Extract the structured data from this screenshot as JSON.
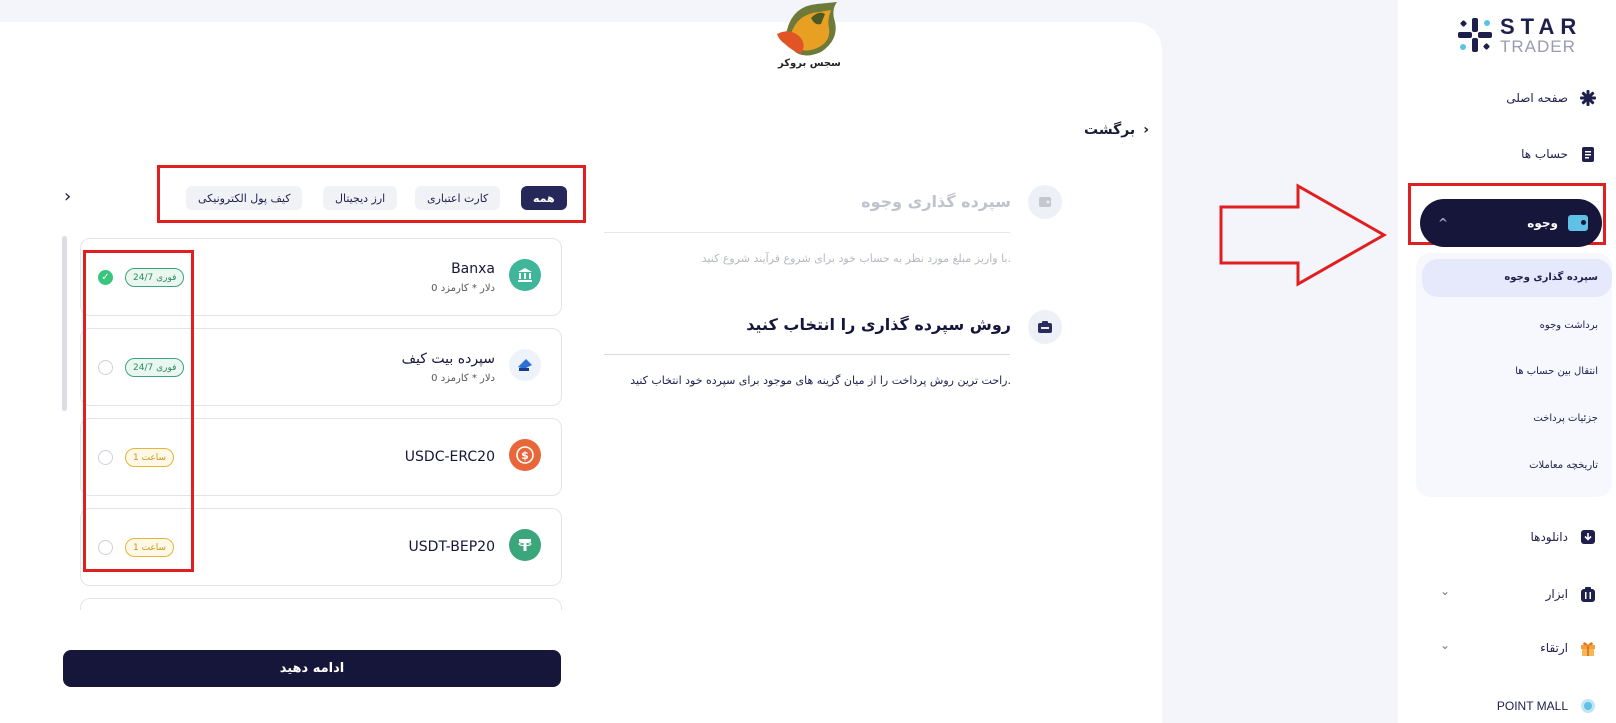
{
  "brand": {
    "name_fa": "سجس بروکر"
  },
  "logo": {
    "line1": "STAR",
    "line2": "TRADER"
  },
  "sidebar": {
    "items": [
      {
        "label": "صفحه اصلی"
      },
      {
        "label": "حساب ها"
      },
      {
        "label": "وجوه"
      },
      {
        "label": "دانلودها"
      },
      {
        "label": "ابزار"
      },
      {
        "label": "ارتقاء"
      },
      {
        "label": "POINT MALL"
      }
    ],
    "submenu": [
      {
        "label": "سپرده گذاری وجوه"
      },
      {
        "label": "برداشت وجوه"
      },
      {
        "label": "انتقال بین حساب ها"
      },
      {
        "label": "جزئیات پرداخت"
      },
      {
        "label": "تاریخچه معاملات"
      }
    ]
  },
  "back_label": "برگشت",
  "step1": {
    "title": "سپرده گذاری وجوه",
    "desc": "با واریز مبلغ مورد نظر به حساب خود برای شروع فرآیند شروع کنید."
  },
  "step2": {
    "title": "روش سپرده گذاری را انتخاب کنید",
    "desc": "راحت ترین روش پرداخت را از میان گزینه های موجود برای سپرده خود انتخاب کنید."
  },
  "filters": {
    "all": "همه",
    "card": "کارت اعتباری",
    "crypto": "ارز دیجیتال",
    "ewallet": "کیف پول الکترونیکی"
  },
  "methods": [
    {
      "name": "Banxa",
      "fee": "0 دلار * کارمزد",
      "badge": "24/7 فوری",
      "selected": true,
      "icon": "bank-icon",
      "color": "#3fb59a"
    },
    {
      "name": "سپرده بیت کیف",
      "fee": "0 دلار * کارمزد",
      "badge": "24/7 فوری",
      "selected": false,
      "icon": "bitkif-icon",
      "color": "#2d6fd8"
    },
    {
      "name": "USDC-ERC20",
      "fee": "",
      "badge": "1 ساعت",
      "selected": false,
      "icon": "usdc-icon",
      "color": "#e8673a"
    },
    {
      "name": "USDT-BEP20",
      "fee": "",
      "badge": "1 ساعت",
      "selected": false,
      "icon": "tether-icon",
      "color": "#3ba57b"
    }
  ],
  "continue_label": "ادامه دهید"
}
